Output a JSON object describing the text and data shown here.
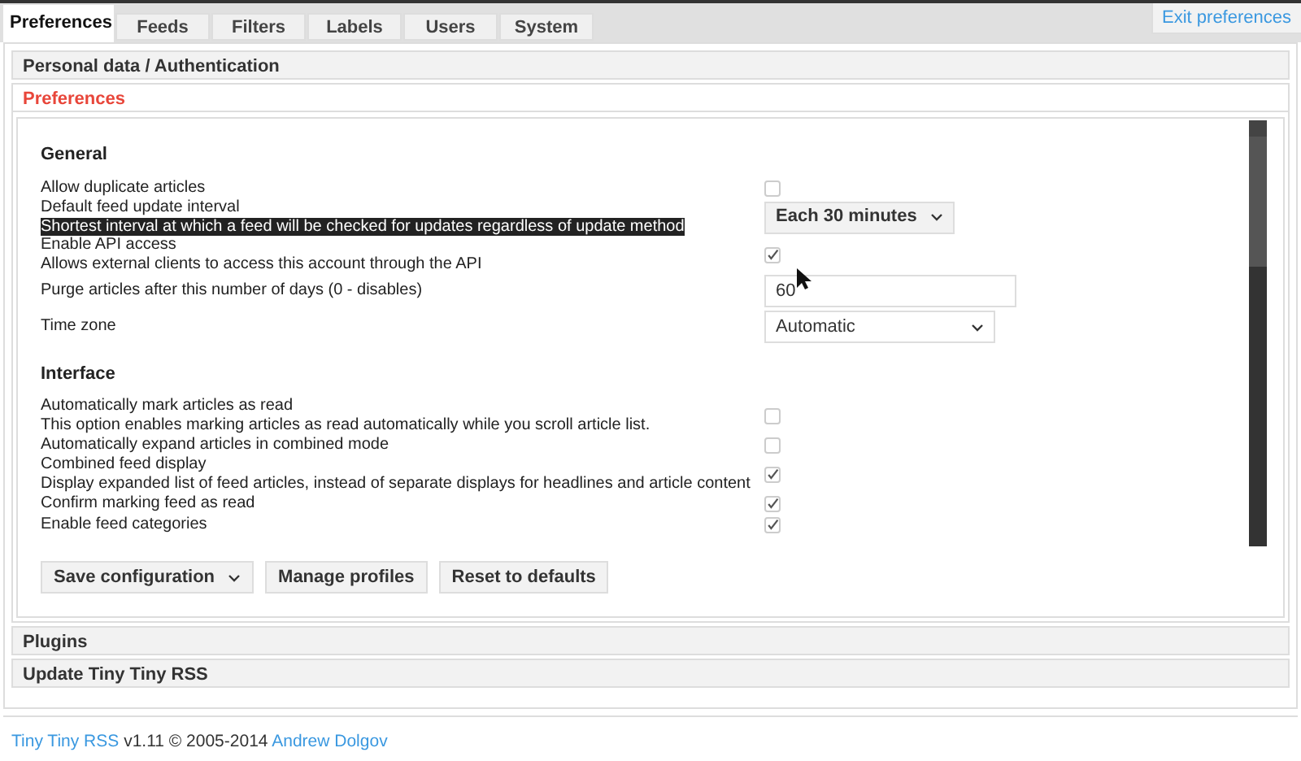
{
  "tabs": [
    {
      "label": "Preferences",
      "selected": true
    },
    {
      "label": "Feeds",
      "selected": false
    },
    {
      "label": "Filters",
      "selected": false
    },
    {
      "label": "Labels",
      "selected": false
    },
    {
      "label": "Users",
      "selected": false
    },
    {
      "label": "System",
      "selected": false
    }
  ],
  "exit_link": "Exit preferences",
  "panels": [
    {
      "title": "Personal data / Authentication",
      "expanded": false
    },
    {
      "title": "Preferences",
      "expanded": true,
      "sections": [
        {
          "title": "General",
          "rows": [
            {
              "kind": "checkbox",
              "label": "Allow duplicate articles",
              "checked": false
            },
            {
              "kind": "select",
              "label": "Default feed update interval",
              "description": "Shortest interval at which a feed will be checked for updates regardless of update method",
              "highlighted": true,
              "value": "Each 30 minutes",
              "bold": true
            },
            {
              "kind": "checkbox",
              "label": "Enable API access",
              "description": "Allows external clients to access this account through the API",
              "highlighted": false,
              "checked": true
            },
            {
              "kind": "input",
              "label": "Purge articles after this number of days (0 - disables)",
              "value": "60"
            },
            {
              "kind": "select",
              "label": "Time zone",
              "value": "Automatic",
              "bold": false
            }
          ]
        },
        {
          "title": "Interface",
          "rows": [
            {
              "kind": "checkbox",
              "label": "Automatically mark articles as read",
              "description": "This option enables marking articles as read automatically while you scroll article list.",
              "highlighted": false,
              "checked": false
            },
            {
              "kind": "checkbox",
              "label": "Automatically expand articles in combined mode",
              "checked": false
            },
            {
              "kind": "checkbox",
              "label": "Combined feed display",
              "description": "Display expanded list of feed articles, instead of separate displays for headlines and article content",
              "highlighted": false,
              "checked": true
            },
            {
              "kind": "checkbox",
              "label": "Confirm marking feed as read",
              "checked": true
            },
            {
              "kind": "checkbox",
              "label": "Enable feed categories",
              "checked": true
            }
          ]
        }
      ],
      "buttons": [
        {
          "label": "Save configuration",
          "dropdown": true
        },
        {
          "label": "Manage profiles",
          "dropdown": false
        },
        {
          "label": "Reset to defaults",
          "dropdown": false
        }
      ]
    },
    {
      "title": "Plugins",
      "expanded": false
    },
    {
      "title": "Update Tiny Tiny RSS",
      "expanded": false
    }
  ],
  "footer": {
    "app_link": "Tiny Tiny RSS",
    "text": "v1.11 © 2005-2014",
    "author_link": "Andrew Dolgov"
  }
}
